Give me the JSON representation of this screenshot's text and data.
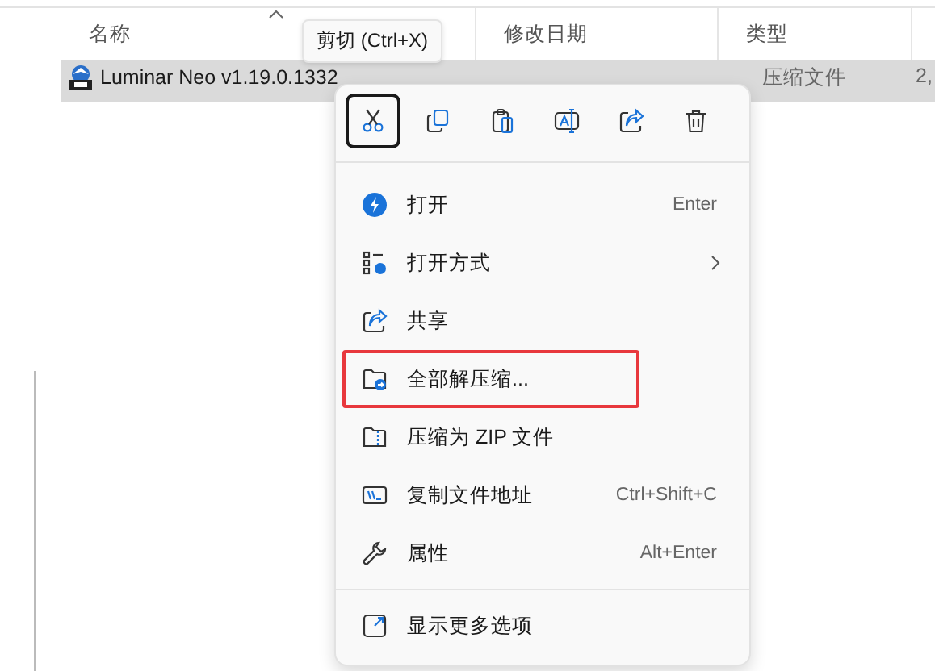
{
  "columns": [
    {
      "label": "名称",
      "sorted": true
    },
    {
      "label": "修改日期",
      "sorted": false
    },
    {
      "label": "类型",
      "sorted": false
    }
  ],
  "files": [
    {
      "name": "Luminar Neo v1.19.0.1332",
      "type": "压缩文件",
      "size": "2,",
      "selected": true
    }
  ],
  "tooltip": "剪切 (Ctrl+X)",
  "menu": {
    "toolbar": [
      {
        "kind": "cut",
        "selected": true
      },
      {
        "kind": "copy",
        "selected": false
      },
      {
        "kind": "paste",
        "selected": false
      },
      {
        "kind": "rename",
        "selected": false
      },
      {
        "kind": "share",
        "selected": false
      },
      {
        "kind": "delete",
        "selected": false
      }
    ],
    "items": [
      {
        "kind": "open",
        "label": "打开",
        "shortcut": "Enter",
        "submenu": false,
        "highlighted": false
      },
      {
        "kind": "open-with",
        "label": "打开方式",
        "submenu": true,
        "highlighted": false
      },
      {
        "kind": "share",
        "label": "共享",
        "submenu": false,
        "highlighted": false
      },
      {
        "kind": "extract",
        "label": "全部解压缩...",
        "submenu": false,
        "highlighted": true
      },
      {
        "kind": "zip",
        "label": "压缩为 ZIP 文件",
        "submenu": false,
        "highlighted": false
      },
      {
        "kind": "copy-path",
        "label": "复制文件地址",
        "shortcut": "Ctrl+Shift+C",
        "submenu": false,
        "highlighted": false
      },
      {
        "kind": "properties",
        "label": "属性",
        "shortcut": "Alt+Enter",
        "submenu": false,
        "highlighted": false
      }
    ],
    "footer": [
      {
        "kind": "more",
        "label": "显示更多选项",
        "submenu": false,
        "highlighted": false
      }
    ]
  }
}
